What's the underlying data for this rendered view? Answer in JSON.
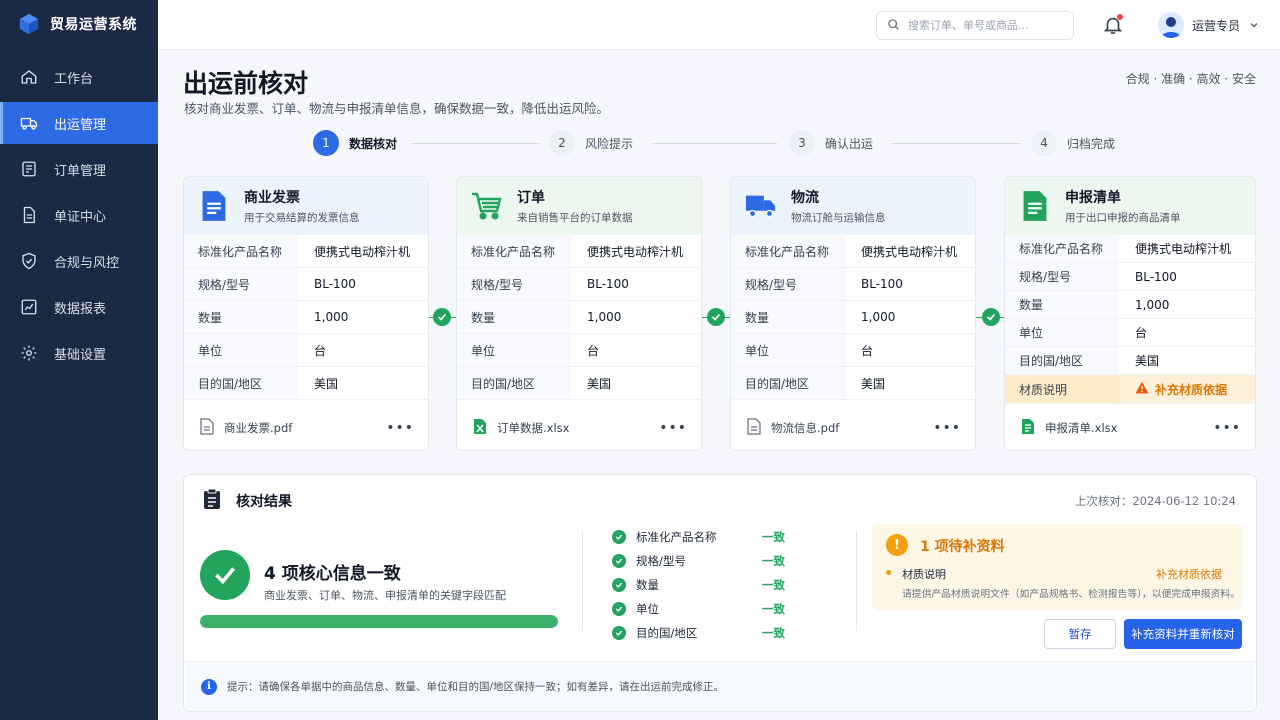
{
  "app": {
    "name": "贸易运营系统"
  },
  "sidebar": {
    "items": [
      {
        "label": "工作台",
        "icon": "home-icon",
        "active": false
      },
      {
        "label": "出运管理",
        "icon": "truck-icon",
        "active": true
      },
      {
        "label": "订单管理",
        "icon": "order-icon",
        "active": false
      },
      {
        "label": "单证中心",
        "icon": "document-icon",
        "active": false
      },
      {
        "label": "合规与风控",
        "icon": "shield-icon",
        "active": false
      },
      {
        "label": "数据报表",
        "icon": "chart-icon",
        "active": false
      },
      {
        "label": "基础设置",
        "icon": "gear-icon",
        "active": false
      }
    ]
  },
  "header": {
    "search_placeholder": "搜索订单、单号或商品...",
    "user_name": "运营专员"
  },
  "page": {
    "title": "出运前核对",
    "subtitle": "核对商业发票、订单、物流与申报清单信息，确保数据一致，降低出运风险。",
    "tags": "合规 · 准确 · 高效 · 安全"
  },
  "steps": [
    {
      "num": "1",
      "label": "数据核对",
      "active": true
    },
    {
      "num": "2",
      "label": "风险提示",
      "active": false
    },
    {
      "num": "3",
      "label": "确认出运",
      "active": false
    },
    {
      "num": "4",
      "label": "归档完成",
      "active": false
    }
  ],
  "cards": [
    {
      "title": "商业发票",
      "desc": "用于交易结算的发票信息",
      "rows": [
        {
          "k": "标准化产品名称",
          "v": "便携式电动榨汁机"
        },
        {
          "k": "规格/型号",
          "v": "BL-100"
        },
        {
          "k": "数量",
          "v": "1,000"
        },
        {
          "k": "单位",
          "v": "台"
        },
        {
          "k": "目的国/地区",
          "v": "美国"
        }
      ],
      "file": "商业发票.pdf"
    },
    {
      "title": "订单",
      "desc": "来自销售平台的订单数据",
      "rows": [
        {
          "k": "标准化产品名称",
          "v": "便携式电动榨汁机"
        },
        {
          "k": "规格/型号",
          "v": "BL-100"
        },
        {
          "k": "数量",
          "v": "1,000"
        },
        {
          "k": "单位",
          "v": "台"
        },
        {
          "k": "目的国/地区",
          "v": "美国"
        }
      ],
      "file": "订单数据.xlsx"
    },
    {
      "title": "物流",
      "desc": "物流订舱与运输信息",
      "rows": [
        {
          "k": "标准化产品名称",
          "v": "便携式电动榨汁机"
        },
        {
          "k": "规格/型号",
          "v": "BL-100"
        },
        {
          "k": "数量",
          "v": "1,000"
        },
        {
          "k": "单位",
          "v": "台"
        },
        {
          "k": "目的国/地区",
          "v": "美国"
        }
      ],
      "file": "物流信息.pdf"
    },
    {
      "title": "申报清单",
      "desc": "用于出口申报的商品清单",
      "rows": [
        {
          "k": "标准化产品名称",
          "v": "便携式电动榨汁机"
        },
        {
          "k": "规格/型号",
          "v": "BL-100"
        },
        {
          "k": "数量",
          "v": "1,000"
        },
        {
          "k": "单位",
          "v": "台"
        },
        {
          "k": "目的国/地区",
          "v": "美国"
        },
        {
          "k": "材质说明",
          "v": "补充材质依据"
        }
      ],
      "file": "申报清单.xlsx"
    }
  ],
  "result": {
    "title": "核对结果",
    "last_check": "上次核对：2024-06-12  10:24",
    "summary_title": "4 项核心信息一致",
    "summary_desc": "商业发票、订单、物流、申报清单的关键字段匹配",
    "progress": 1.0,
    "checks": [
      {
        "name": "标准化产品名称",
        "status": "一致"
      },
      {
        "name": "规格/型号",
        "status": "一致"
      },
      {
        "name": "数量",
        "status": "一致"
      },
      {
        "name": "单位",
        "status": "一致"
      },
      {
        "name": "目的国/地区",
        "status": "一致"
      }
    ],
    "pending": {
      "title": "1 项待补资料",
      "item": "材质说明",
      "action": "补充材质依据",
      "note": "请提供产品材质说明文件（如产品规格书、检测报告等），以便完成申报资料。"
    },
    "save_label": "暂存",
    "submit_label": "补充资料并重新核对",
    "tip": "提示：请确保各单据中的商品信息、数量、单位和目的国/地区保持一致；如有差异，请在出运前完成修正。"
  },
  "colors": {
    "primary": "#2d6ae3",
    "success": "#22a45d",
    "warning": "#f59e0b",
    "sidebar": "#1b2a44"
  }
}
